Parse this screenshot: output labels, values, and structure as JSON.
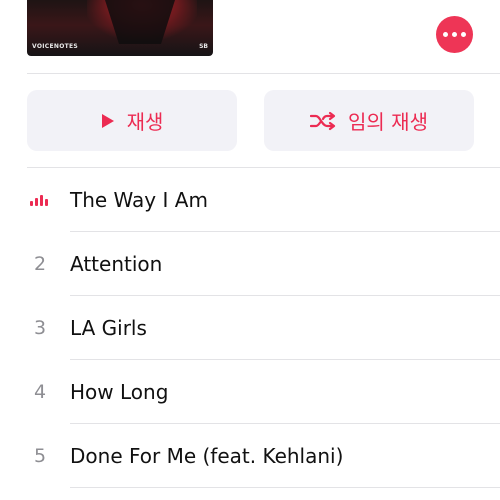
{
  "album": {
    "artwork_text": "VOICENOTES",
    "artwork_mark": "SB"
  },
  "accent_color": "#ec2b52",
  "more_button": {
    "icon": "ellipsis-icon"
  },
  "actions": {
    "play": {
      "label": "재생",
      "icon": "play-icon"
    },
    "shuffle": {
      "label": "임의 재생",
      "icon": "shuffle-icon"
    }
  },
  "tracks": [
    {
      "number": "",
      "title": "The Way I Am",
      "now_playing": true
    },
    {
      "number": "2",
      "title": "Attention",
      "now_playing": false
    },
    {
      "number": "3",
      "title": "LA Girls",
      "now_playing": false
    },
    {
      "number": "4",
      "title": "How Long",
      "now_playing": false
    },
    {
      "number": "5",
      "title": "Done For Me (feat. Kehlani)",
      "now_playing": false
    }
  ]
}
